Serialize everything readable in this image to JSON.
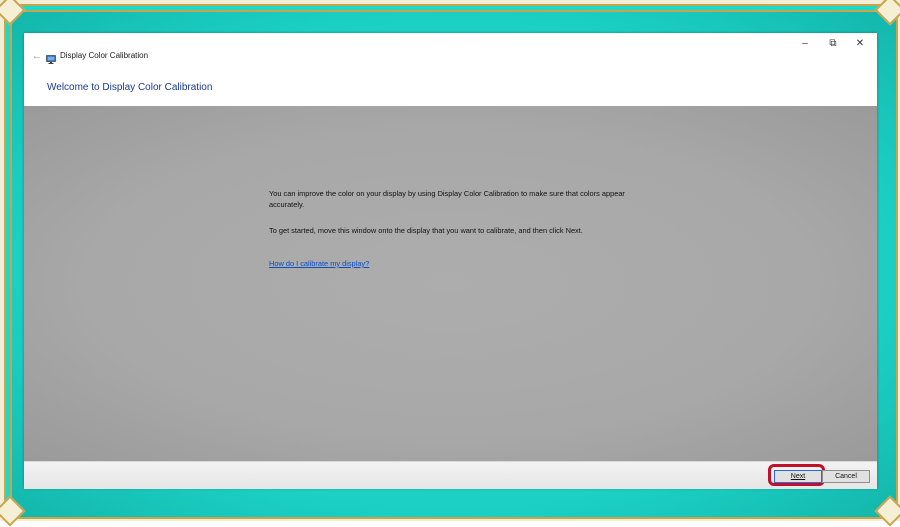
{
  "window": {
    "title": "Display Color Calibration",
    "controls": {
      "minimize": "–",
      "maximize": "⧉",
      "close": "✕"
    },
    "back_icon": "←"
  },
  "header": {
    "title": "Welcome to Display Color Calibration"
  },
  "content": {
    "paragraph1": "You can improve the color on your display by using Display Color Calibration to make sure that colors appear accurately.",
    "paragraph2": "To get started, move this window onto the display that you want to calibrate, and then click Next.",
    "help_link": "How do I calibrate my display?"
  },
  "footer": {
    "next_label": "Next",
    "cancel_label": "Cancel"
  },
  "icons": {
    "back": "back-arrow-icon",
    "app": "monitor-icon",
    "minimize": "minimize-icon",
    "maximize": "restore-icon",
    "close": "close-icon"
  },
  "colors": {
    "frame": "#1fd8cc",
    "frame_trim": "#c9a54a",
    "header_title": "#1b3a8c",
    "link": "#0b4fc7",
    "highlight": "#c0102a",
    "content_bg": "#a8a8a8"
  }
}
